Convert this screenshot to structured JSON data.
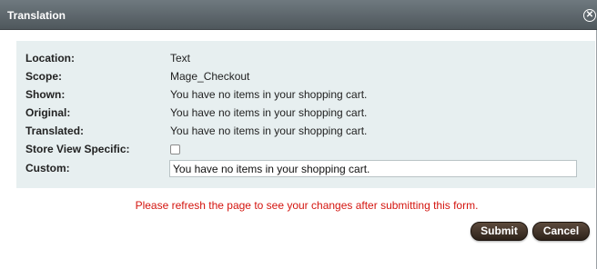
{
  "dialog": {
    "title": "Translation",
    "close_icon": "close-icon"
  },
  "fields": {
    "location": {
      "label": "Location:",
      "value": "Text"
    },
    "scope": {
      "label": "Scope:",
      "value": "Mage_Checkout"
    },
    "shown": {
      "label": "Shown:",
      "value": "You have no items in your shopping cart."
    },
    "original": {
      "label": "Original:",
      "value": "You have no items in your shopping cart."
    },
    "translated": {
      "label": "Translated:",
      "value": "You have no items in your shopping cart."
    },
    "store_view_specific": {
      "label": "Store View Specific:",
      "checked": false
    },
    "custom": {
      "label": "Custom:",
      "value": "You have no items in your shopping cart."
    }
  },
  "notice": "Please refresh the page to see your changes after submitting this form.",
  "buttons": {
    "submit": "Submit",
    "cancel": "Cancel"
  },
  "colors": {
    "titlebar": "#5e676d",
    "panel": "#e7eff0",
    "notice": "#d4150f",
    "button": "#3e3127"
  }
}
